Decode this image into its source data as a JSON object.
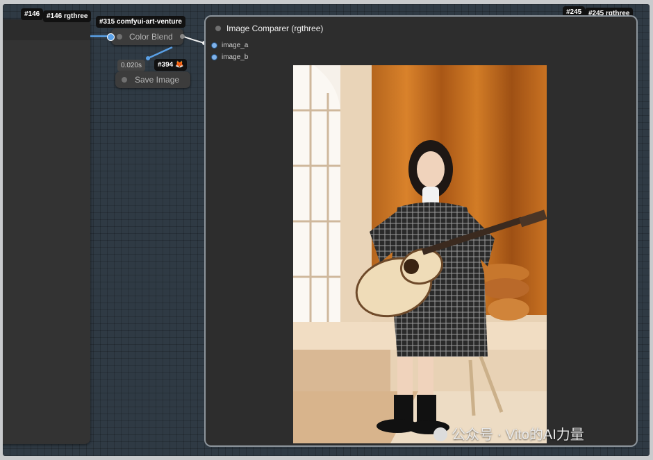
{
  "nodes": {
    "left_badge": "#146",
    "left_badge2": "#146 rgthree",
    "color_blend": {
      "badge": "#315 comfyui-art-venture",
      "title": "Color Blend"
    },
    "save_image": {
      "badge": "#394 🦊",
      "timer": "0.020s",
      "title": "Save Image"
    },
    "comparer": {
      "badge_a": "#245",
      "badge_b": "#245 rgthree",
      "title": "Image Comparer (rgthree)",
      "inputs": [
        "image_a",
        "image_b"
      ]
    }
  },
  "watermark": "公众号 · Vito的AI力量",
  "colors": {
    "canvas": "#2f3a44",
    "link_blue": "#5aa0e6",
    "node_bg": "#353535"
  },
  "icons": [
    "node-status-dot-icon",
    "input-socket-icon",
    "wechat-logo-icon"
  ]
}
